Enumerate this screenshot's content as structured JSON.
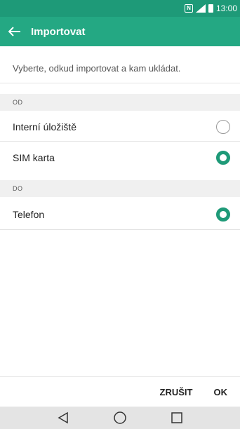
{
  "status_bar": {
    "time": "13:00",
    "icons": [
      "nfc-icon",
      "signal-icon",
      "battery-icon"
    ]
  },
  "app_bar": {
    "title": "Importovat",
    "back_icon": "back-arrow-icon"
  },
  "intro_text": "Vyberte, odkud importovat a kam ukládat.",
  "sections": [
    {
      "header": "OD",
      "options": [
        {
          "label": "Interní úložiště",
          "selected": false
        },
        {
          "label": "SIM karta",
          "selected": true
        }
      ]
    },
    {
      "header": "DO",
      "options": [
        {
          "label": "Telefon",
          "selected": true
        }
      ]
    }
  ],
  "buttons": {
    "cancel": "ZRUŠIT",
    "ok": "OK"
  },
  "nav_bar": {
    "icons": [
      "back-triangle-icon",
      "home-circle-icon",
      "recents-square-icon"
    ]
  },
  "colors": {
    "status_bar": "#1e9a78",
    "app_bar": "#24a883",
    "accent": "#1e9a78"
  }
}
